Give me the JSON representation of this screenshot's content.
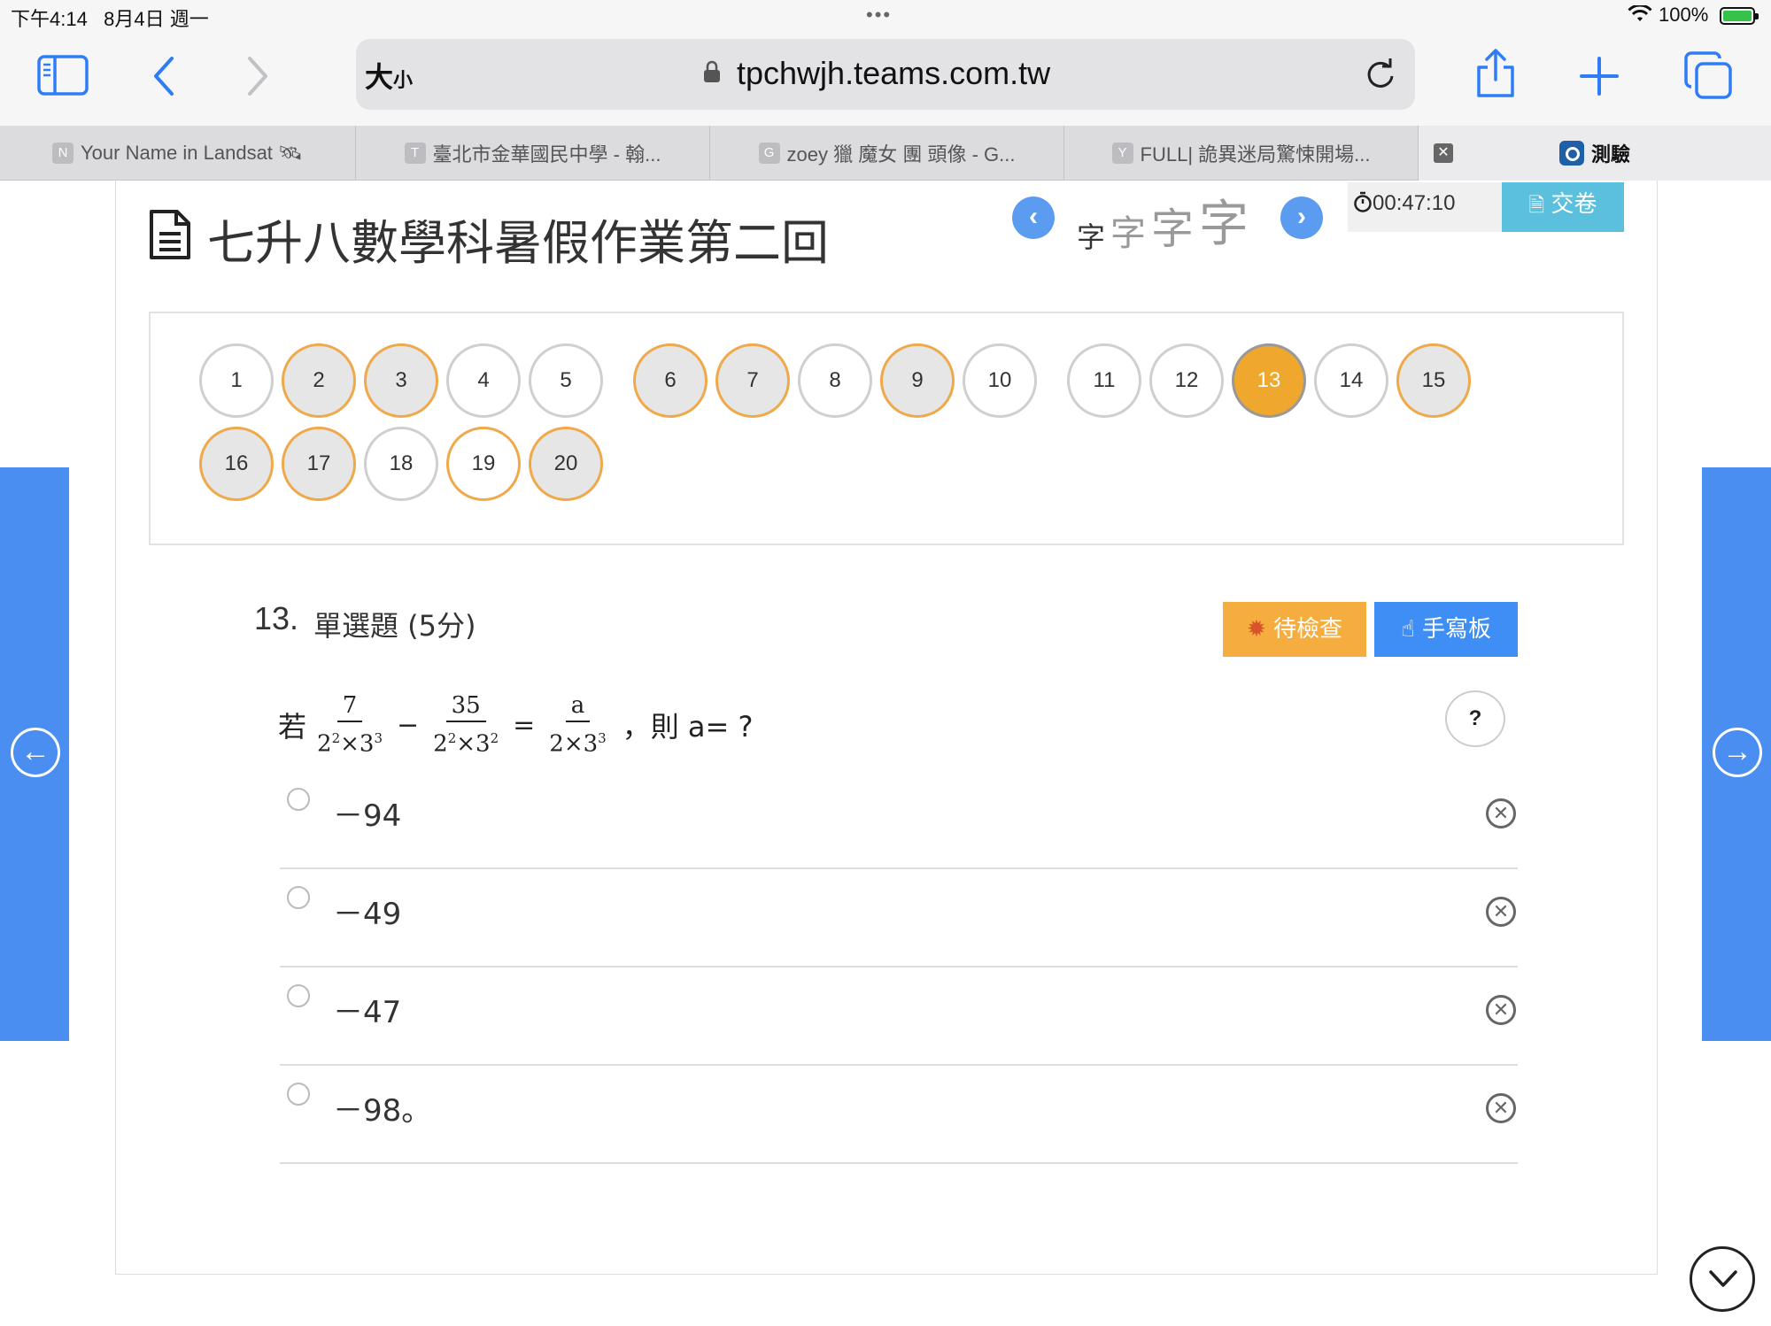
{
  "status": {
    "time": "下午4:14",
    "date": "8月4日 週一",
    "battery": "100%",
    "more_dots": "•••"
  },
  "browser": {
    "aa_label": "大",
    "aa_small": "小",
    "url": "tpchwjh.teams.com.tw",
    "tabs": [
      {
        "fav": "N",
        "title": "Your Name in Landsat 🛰"
      },
      {
        "fav": "T",
        "title": "臺北市金華國民中學 - 翰..."
      },
      {
        "fav": "G",
        "title": "zoey 獵 魔女 團 頭像 - G..."
      },
      {
        "fav": "Y",
        "title": "FULL| 詭異迷局驚悚開場..."
      }
    ],
    "active_tab": "測驗"
  },
  "page": {
    "title": "七升八數學科暑假作業第二回",
    "font_size_chars": [
      "字",
      "字",
      "字",
      "字"
    ],
    "timer": "00:47:10",
    "submit_label": "交卷",
    "question_buttons": [
      {
        "n": "1",
        "state": "unanswered"
      },
      {
        "n": "2",
        "state": "answered"
      },
      {
        "n": "3",
        "state": "answered"
      },
      {
        "n": "4",
        "state": "unanswered"
      },
      {
        "n": "5",
        "state": "unanswered"
      },
      {
        "n": "6",
        "state": "answered"
      },
      {
        "n": "7",
        "state": "answered"
      },
      {
        "n": "8",
        "state": "unanswered"
      },
      {
        "n": "9",
        "state": "answered"
      },
      {
        "n": "10",
        "state": "unanswered"
      },
      {
        "n": "11",
        "state": "unanswered"
      },
      {
        "n": "12",
        "state": "unanswered"
      },
      {
        "n": "13",
        "state": "current"
      },
      {
        "n": "14",
        "state": "unanswered"
      },
      {
        "n": "15",
        "state": "answered"
      },
      {
        "n": "16",
        "state": "answered"
      },
      {
        "n": "17",
        "state": "answered"
      },
      {
        "n": "18",
        "state": "unanswered"
      },
      {
        "n": "19",
        "state": "flagged"
      },
      {
        "n": "20",
        "state": "answered"
      }
    ],
    "question": {
      "number": "13.",
      "type": "單選題 (5分)",
      "pending_label": "待檢查",
      "handwrite_label": "手寫板",
      "help_label": "?",
      "prefix": "若",
      "frac1": {
        "num": "7",
        "den_base1": "2",
        "den_exp1": "2",
        "den_base2": "3",
        "den_exp2": "3"
      },
      "minus": "−",
      "frac2": {
        "num": "35",
        "den_base1": "2",
        "den_exp1": "2",
        "den_base2": "3",
        "den_exp2": "2"
      },
      "equals": "=",
      "frac3": {
        "num": "a",
        "den_base1": "2",
        "den_base2": "3",
        "den_exp2": "3"
      },
      "times": "×",
      "suffix": "，則 a= ?",
      "options": [
        "－94",
        "－49",
        "－47",
        "－98。"
      ]
    }
  },
  "colors": {
    "answered_border": "#efa94a",
    "current_fill": "#efa72d",
    "side_nav": "#4b8ef1",
    "pending": "#f6ad3f",
    "handwrite": "#3f8ef5",
    "submit": "#5bc0de"
  },
  "icons": [
    "sidebar-icon",
    "back-icon",
    "forward-icon",
    "lock-icon",
    "reload-icon",
    "share-icon",
    "new-tab-icon",
    "tabs-overview-icon",
    "document-icon",
    "stopwatch-icon",
    "bug-icon",
    "hand-pointer-icon"
  ]
}
